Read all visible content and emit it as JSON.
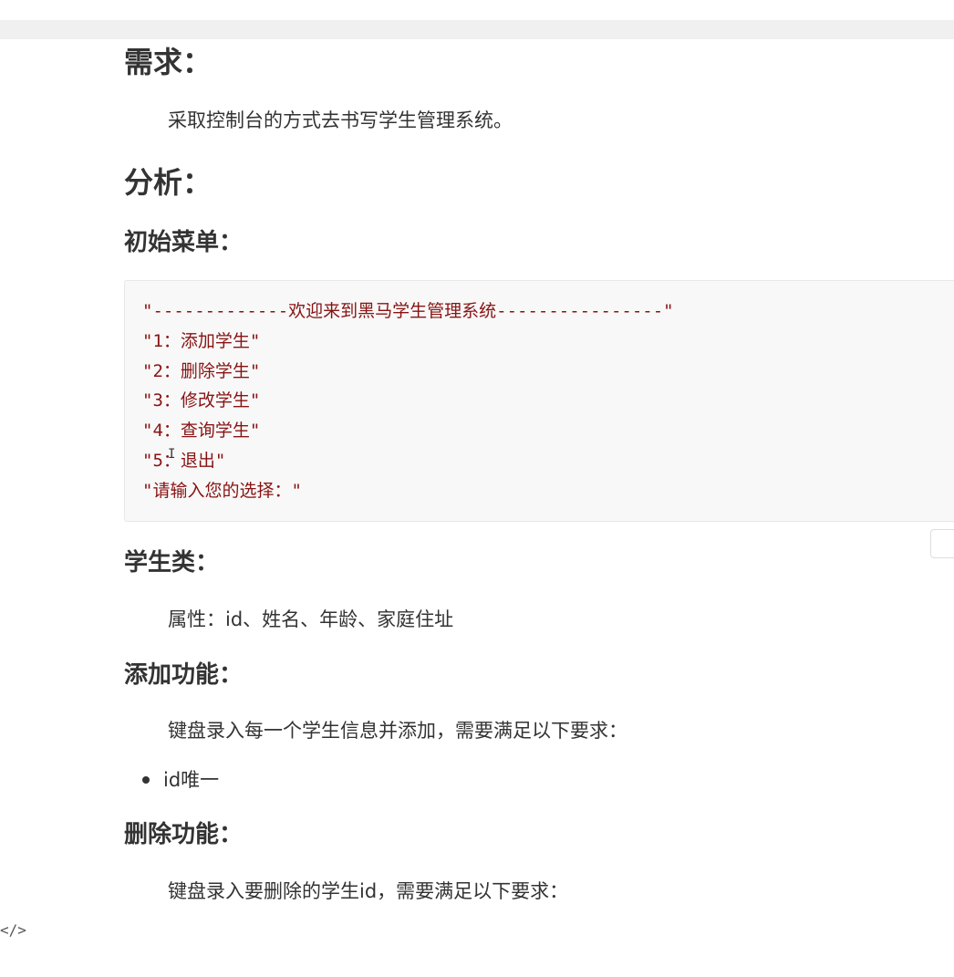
{
  "headings": {
    "requirement": "需求：",
    "analysis": "分析：",
    "initial_menu": "初始菜单：",
    "student_class": "学生类：",
    "add_function": "添加功能：",
    "delete_function": "删除功能："
  },
  "paragraphs": {
    "requirement_text": "采取控制台的方式去书写学生管理系统。",
    "student_attributes": "属性：id、姓名、年龄、家庭住址",
    "add_text": "键盘录入每一个学生信息并添加，需要满足以下要求：",
    "delete_text": "键盘录入要删除的学生id，需要满足以下要求："
  },
  "code_lines": [
    "\"-------------欢迎来到黑马学生管理系统----------------\"",
    "\"1：添加学生\"",
    "\"2：删除学生\"",
    "\"3：修改学生\"",
    "\"4：查询学生\"",
    "\"5：退出\"",
    "\"请输入您的选择：\""
  ],
  "add_requirements": [
    "id唯一"
  ],
  "trailing_tag": "</>",
  "icons": {
    "text_cursor": "text-cursor-icon"
  },
  "colors": {
    "code_text": "#881313",
    "code_background": "#f8f8f8",
    "body_text": "#333333"
  }
}
